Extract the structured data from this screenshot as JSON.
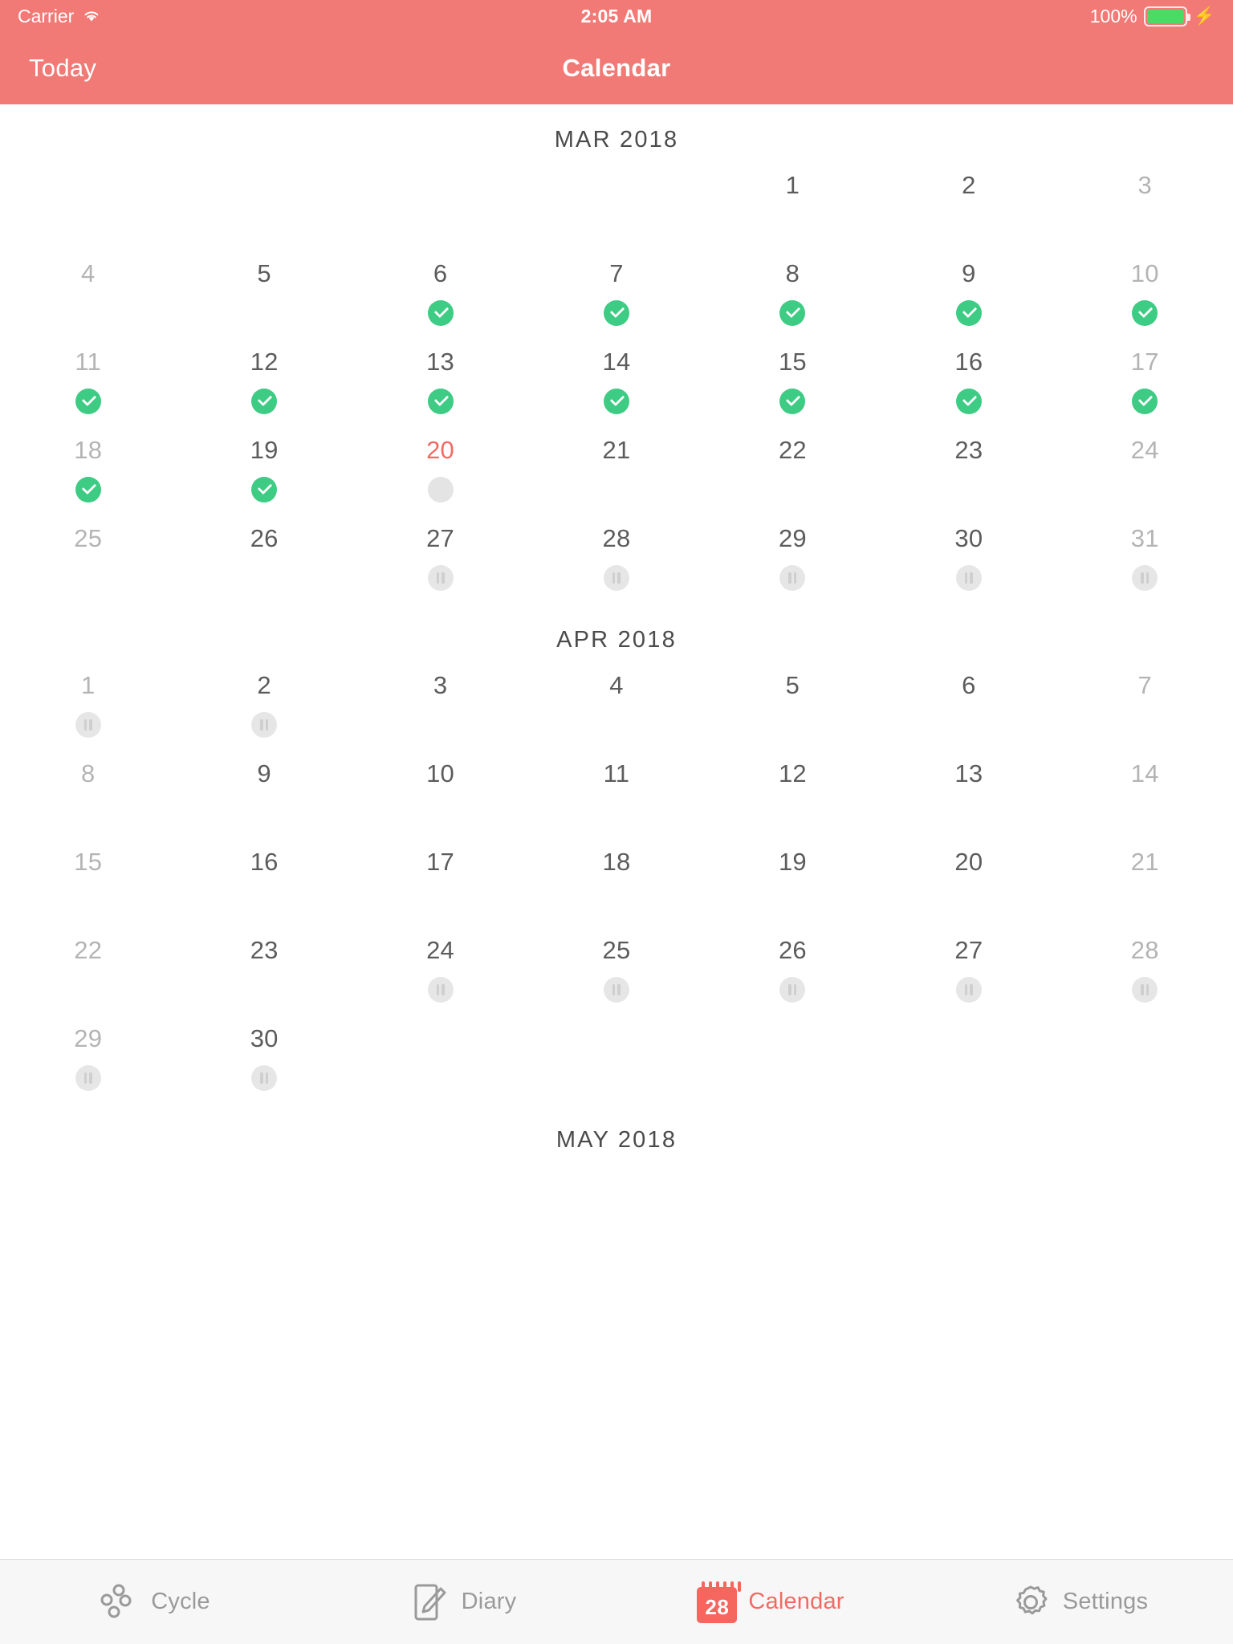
{
  "status_bar": {
    "carrier": "Carrier",
    "wifi_icon": "wifi-icon",
    "time": "2:05 AM",
    "battery_percent": "100%",
    "battery_icon": "battery-full-icon",
    "charging_icon": "lightning-bolt-icon",
    "battery_color": "#4cd964"
  },
  "nav_bar": {
    "left_button": "Today",
    "title": "Calendar",
    "background": "#f27a76"
  },
  "colors": {
    "accent": "#f27a76",
    "today": "#f36a62",
    "check_green": "#3ecb84",
    "pause_gray": "#e6e6e6",
    "dot_gray": "#e4e4e4",
    "weekday_text": "#5c5c5c",
    "weekend_text": "#b4b4b4"
  },
  "months": [
    {
      "title": "MAR 2018",
      "weeks": [
        [
          {
            "num": "",
            "marker": "none",
            "empty": true,
            "weekend": true
          },
          {
            "num": "",
            "marker": "none",
            "empty": true
          },
          {
            "num": "",
            "marker": "none",
            "empty": true
          },
          {
            "num": "",
            "marker": "none",
            "empty": true
          },
          {
            "num": "1",
            "marker": "none"
          },
          {
            "num": "2",
            "marker": "none"
          },
          {
            "num": "3",
            "marker": "none",
            "weekend": true
          }
        ],
        [
          {
            "num": "4",
            "marker": "none",
            "weekend": true
          },
          {
            "num": "5",
            "marker": "none"
          },
          {
            "num": "6",
            "marker": "check"
          },
          {
            "num": "7",
            "marker": "check"
          },
          {
            "num": "8",
            "marker": "check"
          },
          {
            "num": "9",
            "marker": "check"
          },
          {
            "num": "10",
            "marker": "check",
            "weekend": true
          }
        ],
        [
          {
            "num": "11",
            "marker": "check",
            "weekend": true
          },
          {
            "num": "12",
            "marker": "check"
          },
          {
            "num": "13",
            "marker": "check"
          },
          {
            "num": "14",
            "marker": "check"
          },
          {
            "num": "15",
            "marker": "check"
          },
          {
            "num": "16",
            "marker": "check"
          },
          {
            "num": "17",
            "marker": "check",
            "weekend": true
          }
        ],
        [
          {
            "num": "18",
            "marker": "check",
            "weekend": true
          },
          {
            "num": "19",
            "marker": "check"
          },
          {
            "num": "20",
            "marker": "dot",
            "today": true
          },
          {
            "num": "21",
            "marker": "none"
          },
          {
            "num": "22",
            "marker": "none"
          },
          {
            "num": "23",
            "marker": "none"
          },
          {
            "num": "24",
            "marker": "none",
            "weekend": true
          }
        ],
        [
          {
            "num": "25",
            "marker": "none",
            "weekend": true
          },
          {
            "num": "26",
            "marker": "none"
          },
          {
            "num": "27",
            "marker": "pause"
          },
          {
            "num": "28",
            "marker": "pause"
          },
          {
            "num": "29",
            "marker": "pause"
          },
          {
            "num": "30",
            "marker": "pause"
          },
          {
            "num": "31",
            "marker": "pause",
            "weekend": true
          }
        ]
      ]
    },
    {
      "title": "APR 2018",
      "weeks": [
        [
          {
            "num": "1",
            "marker": "pause",
            "weekend": true
          },
          {
            "num": "2",
            "marker": "pause"
          },
          {
            "num": "3",
            "marker": "none"
          },
          {
            "num": "4",
            "marker": "none"
          },
          {
            "num": "5",
            "marker": "none"
          },
          {
            "num": "6",
            "marker": "none"
          },
          {
            "num": "7",
            "marker": "none",
            "weekend": true
          }
        ],
        [
          {
            "num": "8",
            "marker": "none",
            "weekend": true
          },
          {
            "num": "9",
            "marker": "none"
          },
          {
            "num": "10",
            "marker": "none"
          },
          {
            "num": "11",
            "marker": "none"
          },
          {
            "num": "12",
            "marker": "none"
          },
          {
            "num": "13",
            "marker": "none"
          },
          {
            "num": "14",
            "marker": "none",
            "weekend": true
          }
        ],
        [
          {
            "num": "15",
            "marker": "none",
            "weekend": true
          },
          {
            "num": "16",
            "marker": "none"
          },
          {
            "num": "17",
            "marker": "none"
          },
          {
            "num": "18",
            "marker": "none"
          },
          {
            "num": "19",
            "marker": "none"
          },
          {
            "num": "20",
            "marker": "none"
          },
          {
            "num": "21",
            "marker": "none",
            "weekend": true
          }
        ],
        [
          {
            "num": "22",
            "marker": "none",
            "weekend": true
          },
          {
            "num": "23",
            "marker": "none"
          },
          {
            "num": "24",
            "marker": "pause"
          },
          {
            "num": "25",
            "marker": "pause"
          },
          {
            "num": "26",
            "marker": "pause"
          },
          {
            "num": "27",
            "marker": "pause"
          },
          {
            "num": "28",
            "marker": "pause",
            "weekend": true
          }
        ],
        [
          {
            "num": "29",
            "marker": "pause",
            "weekend": true
          },
          {
            "num": "30",
            "marker": "pause"
          },
          {
            "num": "",
            "marker": "none",
            "empty": true
          },
          {
            "num": "",
            "marker": "none",
            "empty": true
          },
          {
            "num": "",
            "marker": "none",
            "empty": true
          },
          {
            "num": "",
            "marker": "none",
            "empty": true
          },
          {
            "num": "",
            "marker": "none",
            "empty": true,
            "weekend": true
          }
        ]
      ]
    },
    {
      "title": "MAY 2018",
      "weeks": []
    }
  ],
  "tab_bar": {
    "tabs": [
      {
        "label": "Cycle",
        "icon": "cycle-icon",
        "active": false
      },
      {
        "label": "Diary",
        "icon": "diary-notebook-pencil-icon",
        "active": false
      },
      {
        "label": "Calendar",
        "icon": "calendar-28-icon",
        "active": true,
        "icon_day": "28"
      },
      {
        "label": "Settings",
        "icon": "gear-icon",
        "active": false
      }
    ]
  }
}
